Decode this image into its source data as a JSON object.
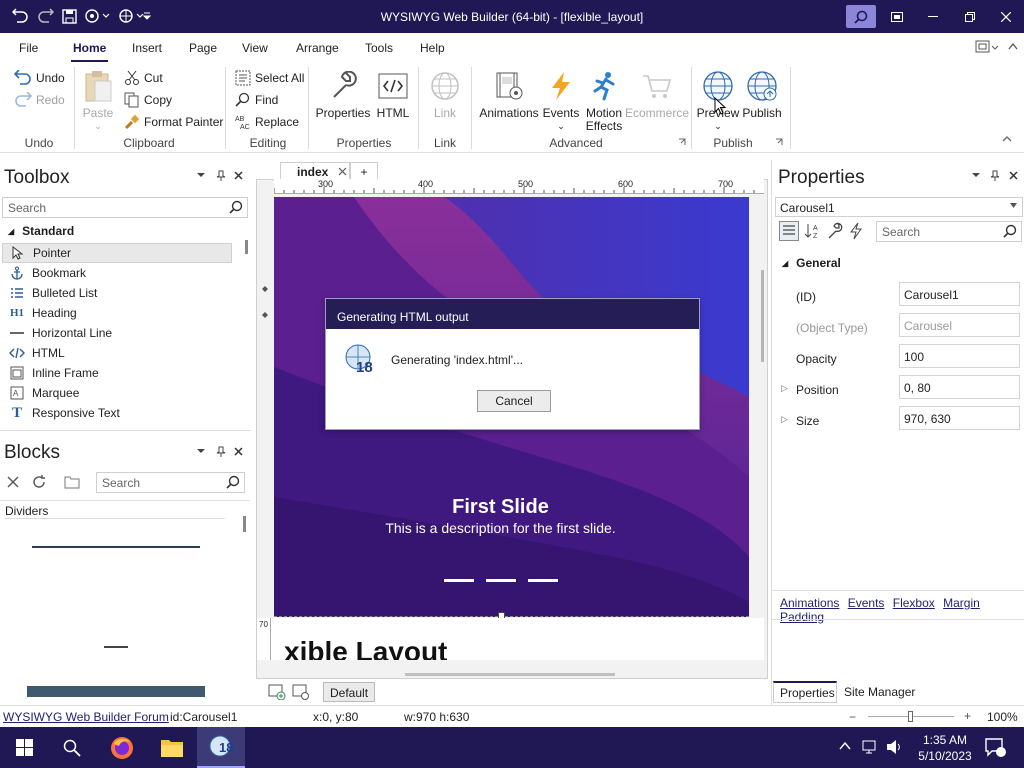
{
  "window": {
    "title": "WYSIWYG Web Builder (64-bit) - [flexible_layout]"
  },
  "menu": {
    "items": [
      "File",
      "Home",
      "Insert",
      "Page",
      "View",
      "Arrange",
      "Tools",
      "Help"
    ],
    "active": "Home"
  },
  "ribbon": {
    "undo": {
      "undo": "Undo",
      "redo": "Redo",
      "label": "Undo"
    },
    "clipboard": {
      "paste": "Paste",
      "cut": "Cut",
      "copy": "Copy",
      "format_painter": "Format Painter",
      "label": "Clipboard"
    },
    "editing": {
      "select_all": "Select All",
      "find": "Find",
      "replace": "Replace",
      "label": "Editing"
    },
    "properties": {
      "properties": "Properties",
      "html": "HTML",
      "label": "Properties"
    },
    "link": {
      "link": "Link",
      "label": "Link"
    },
    "advanced": {
      "animations": "Animations",
      "events": "Events",
      "motion_effects_1": "Motion",
      "motion_effects_2": "Effects",
      "ecommerce": "Ecommerce",
      "label": "Advanced"
    },
    "publish": {
      "preview": "Preview",
      "publish": "Publish",
      "label": "Publish"
    }
  },
  "toolbox": {
    "title": "Toolbox",
    "search_placeholder": "Search",
    "category": "Standard",
    "items": [
      "Pointer",
      "Bookmark",
      "Bulleted List",
      "Heading",
      "Horizontal Line",
      "HTML",
      "Inline Frame",
      "Marquee",
      "Responsive Text"
    ]
  },
  "blocks": {
    "title": "Blocks",
    "search_placeholder": "Search",
    "category": "Dividers"
  },
  "tabs": {
    "active": "index",
    "add": "+"
  },
  "ruler": {
    "marks": [
      "300",
      "400",
      "500",
      "600",
      "700"
    ],
    "vmark": "70"
  },
  "slide": {
    "heading": "First Slide",
    "description": "This is a description for the first slide."
  },
  "page_heading_fragment": "xible Layout",
  "dialog": {
    "title": "Generating HTML output",
    "message": "Generating 'index.html'...",
    "cancel": "Cancel",
    "badge": "18"
  },
  "properties": {
    "title": "Properties",
    "object": "Carousel1",
    "search_placeholder": "Search",
    "section": "General",
    "rows": [
      {
        "name": "(ID)",
        "value": "Carousel1",
        "disabled": false
      },
      {
        "name": "(Object Type)",
        "value": "Carousel",
        "disabled": true
      },
      {
        "name": "Opacity",
        "value": "100",
        "disabled": false
      },
      {
        "name": "Position",
        "value": "0, 80",
        "disabled": false
      },
      {
        "name": "Size",
        "value": "970, 630",
        "disabled": false
      }
    ],
    "links": [
      "Animations",
      "Events",
      "Flexbox",
      "Margin",
      "Padding"
    ],
    "bottom_tabs": [
      "Properties",
      "Site Manager"
    ]
  },
  "view_mode": "Default",
  "status": {
    "forum": "WYSIWYG Web Builder Forum",
    "id": "id:Carousel1",
    "pos": "x:0, y:80",
    "size": "w:970 h:630",
    "zoom": "100%"
  },
  "taskbar": {
    "time": "1:35 AM",
    "date": "5/10/2023",
    "app_badge": "18"
  },
  "colors": {
    "titlebar": "#1f1854",
    "accent": "#1f1854",
    "slide": "#3e1b84"
  }
}
